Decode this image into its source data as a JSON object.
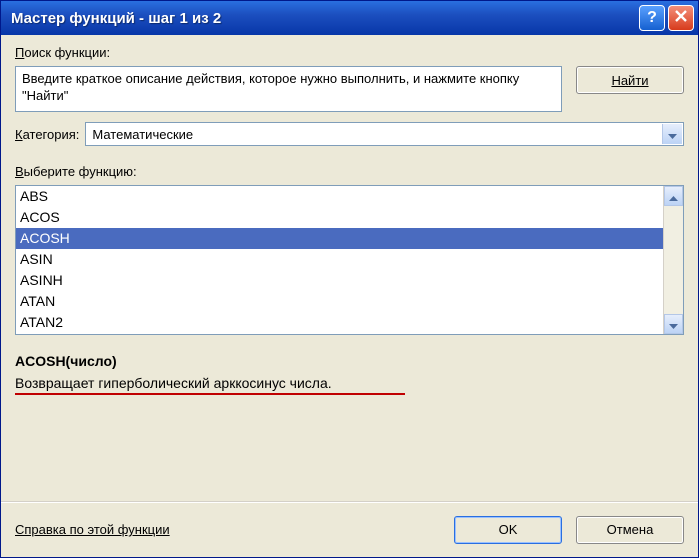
{
  "title": "Мастер функций - шаг 1 из 2",
  "search": {
    "label": "Поиск функции:",
    "value": "Введите краткое описание действия, которое нужно выполнить, и нажмите кнопку \"Найти\"",
    "find_label": "Найти"
  },
  "category": {
    "label": "Категория:",
    "selected": "Математические"
  },
  "select_label": "Выберите функцию:",
  "functions": [
    "ABS",
    "ACOS",
    "ACOSH",
    "ASIN",
    "ASINH",
    "ATAN",
    "ATAN2"
  ],
  "selected_function_index": 2,
  "detail": {
    "signature": "ACOSH(число)",
    "description": "Возвращает гиперболический арккосинус числа."
  },
  "footer": {
    "help": "Справка по этой функции",
    "ok": "OK",
    "cancel": "Отмена"
  }
}
